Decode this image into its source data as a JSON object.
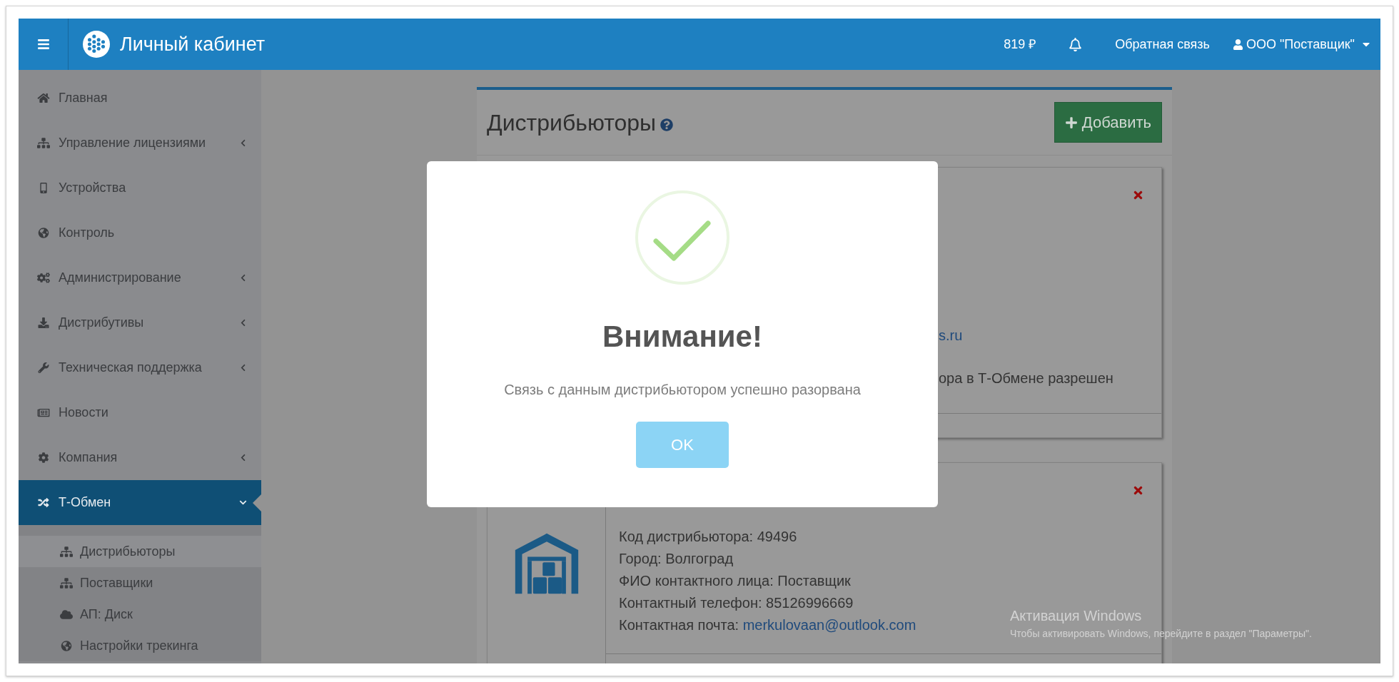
{
  "header": {
    "brand": "Личный кабинет",
    "balance": "819 ₽",
    "feedback": "Обратная связь",
    "user": "ООО \"Поставщик\""
  },
  "sidebar": {
    "items": [
      {
        "label": "Главная",
        "submenu": false,
        "selected": false
      },
      {
        "label": "Управление лицензиями",
        "submenu": true,
        "expanded": false,
        "selected": false
      },
      {
        "label": "Устройства",
        "submenu": false,
        "selected": false
      },
      {
        "label": "Контроль",
        "submenu": false,
        "selected": false
      },
      {
        "label": "Администрирование",
        "submenu": true,
        "expanded": false,
        "selected": false
      },
      {
        "label": "Дистрибутивы",
        "submenu": true,
        "expanded": false,
        "selected": false
      },
      {
        "label": "Техническая поддержка",
        "submenu": true,
        "expanded": false,
        "selected": false
      },
      {
        "label": "Новости",
        "submenu": false,
        "selected": false
      },
      {
        "label": "Компания",
        "submenu": true,
        "expanded": false,
        "selected": false
      },
      {
        "label": "Т-Обмен",
        "submenu": true,
        "expanded": true,
        "selected": true,
        "children": [
          {
            "label": "Дистрибьюторы",
            "selected": true
          },
          {
            "label": "Поставщики",
            "selected": false
          },
          {
            "label": "АП: Диск",
            "selected": false
          },
          {
            "label": "Настройки трекинга",
            "selected": false
          }
        ]
      }
    ]
  },
  "panel": {
    "title": "Дистрибьюторы",
    "add_button": "Добавить",
    "cards": [
      {
        "kind": "partial",
        "lines": [
          {
            "link": "s.ru"
          },
          {
            "text": "ора в Т-Обмене разрешен"
          }
        ]
      },
      {
        "kind": "full",
        "lines": [
          {
            "text": "Код дистрибьютора: 49496"
          },
          {
            "text": "Город: Волгоград"
          },
          {
            "text": "ФИО контактного лица: Поставщик"
          },
          {
            "text": "Контактный телефон: 85126996669"
          },
          {
            "text": "Контактная почта: ",
            "link": "merkulovaan@outlook.com"
          }
        ]
      }
    ]
  },
  "modal": {
    "title": "Внимание!",
    "message": "Связь с данным дистрибьютором успешно разорвана",
    "ok_button": "OK"
  },
  "os_notice": {
    "title": "Активация Windows",
    "message": "Чтобы активировать Windows, перейдите в раздел \"Параметры\"."
  }
}
